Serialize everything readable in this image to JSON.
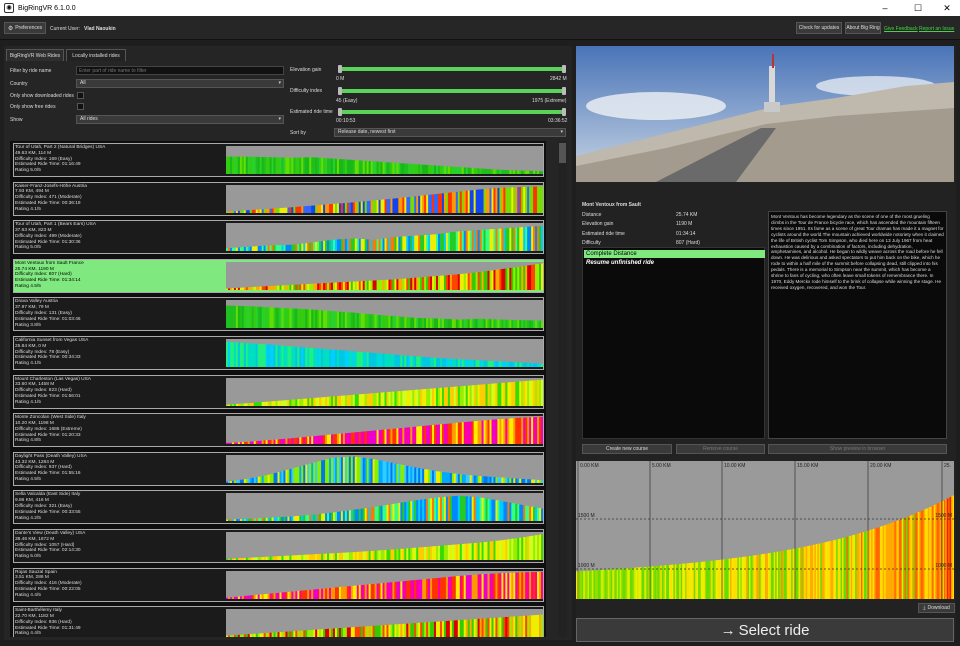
{
  "window": {
    "title": "BigRingVR 6.1.0.0",
    "minimize_glyph": "–",
    "maximize_glyph": "☐",
    "close_glyph": "✕"
  },
  "toolbar": {
    "preferences": "Preferences",
    "current_user_label": "Current User:",
    "current_user": "Vlad Naoukin",
    "check_updates": "Check for updates",
    "about": "About Big Ring",
    "feedback": "Give Feedback",
    "report_issue": "Report an Issue"
  },
  "tabs": [
    "BigRingVR Web Rides",
    "Locally installed rides"
  ],
  "filters": {
    "filter_label": "Filter by ride name",
    "filter_placeholder": "Enter part of ride name to filter",
    "country_label": "Country",
    "country_value": "All",
    "only_downloaded": "Only show downloaded rides",
    "only_free": "Only show free rides",
    "show_label": "Show",
    "show_value": "All rides",
    "elev_label": "Elevation gain",
    "elev_min": "0 M",
    "elev_max": "2842 M",
    "diff_label": "Difficulty index",
    "diff_min": "45 (Easy)",
    "diff_max": "1975 (Extreme)",
    "time_label": "Estimated ride time",
    "time_min": "00:10:53",
    "time_max": "03:36:52",
    "sort_label": "Sort by",
    "sort_value": "Release date, newest first"
  },
  "rides": [
    {
      "name": "Tour of Utah, Part 2 (Natural Bridges) USA",
      "dist": "49.63 KM, 114 M",
      "diff": "Difficulty Index: 169 (Easy)",
      "time": "Estimated Ride Time: 01:16:49",
      "rating": "Rating 5.0/5",
      "profile": [
        0.62,
        0.62,
        0.6,
        0.58,
        0.6,
        0.55,
        0.5,
        0.45,
        0.4,
        0.35,
        0.3,
        0.25,
        0.2,
        0.15,
        0.12,
        0.1
      ],
      "palette": "green",
      "selected": false
    },
    {
      "name": "Kaiser-Franz-Josefs-Höhe Austria",
      "dist": "7.93 KM, 494 M",
      "diff": "Difficulty Index: 471 (Moderate)",
      "time": "Estimated Ride Time: 00:36:19",
      "rating": "Rating 4.1/5",
      "profile": [
        0.05,
        0.1,
        0.15,
        0.2,
        0.26,
        0.32,
        0.38,
        0.45,
        0.52,
        0.6,
        0.68,
        0.76,
        0.84,
        0.9,
        0.93,
        0.95
      ],
      "palette": "warm-blue",
      "selected": false
    },
    {
      "name": "Tour of Utah, Part 1 (Bears Ears) USA",
      "dist": "37.63 KM, 823 M",
      "diff": "Difficulty Index: 499 (Moderate)",
      "time": "Estimated Ride Time: 01:30:36",
      "rating": "Rating 5.0/5",
      "profile": [
        0.1,
        0.15,
        0.2,
        0.22,
        0.3,
        0.4,
        0.45,
        0.4,
        0.5,
        0.55,
        0.6,
        0.7,
        0.75,
        0.8,
        0.85,
        0.9
      ],
      "palette": "mixed",
      "selected": false
    },
    {
      "name": "Mont Ventoux from Sault France",
      "dist": "25.74 KM, 1190 M",
      "diff": "Difficulty Index: 807 (Hard)",
      "time": "Estimated Ride Time: 01:34:14",
      "rating": "Rating 4.5/5",
      "profile": [
        0.05,
        0.1,
        0.14,
        0.18,
        0.22,
        0.26,
        0.3,
        0.34,
        0.38,
        0.44,
        0.5,
        0.56,
        0.64,
        0.74,
        0.84,
        0.95
      ],
      "palette": "green-red",
      "selected": true
    },
    {
      "name": "Drava Valley Austria",
      "dist": "37.97 KM, 79 M",
      "diff": "Difficulty Index: 131 (Easy)",
      "time": "Estimated Ride Time: 01:03:46",
      "rating": "Rating 3.8/5",
      "profile": [
        0.8,
        0.78,
        0.74,
        0.7,
        0.66,
        0.6,
        0.55,
        0.48,
        0.42,
        0.36,
        0.34,
        0.3,
        0.33,
        0.3,
        0.28,
        0.26
      ],
      "palette": "green",
      "selected": false
    },
    {
      "name": "California Sunset from Vegas USA",
      "dist": "25.84 KM, 0 M",
      "diff": "Difficulty Index: 78 (Easy)",
      "time": "Estimated Ride Time: 00:34:33",
      "rating": "Rating 4.1/5",
      "profile": [
        0.9,
        0.85,
        0.8,
        0.74,
        0.68,
        0.62,
        0.56,
        0.5,
        0.44,
        0.38,
        0.32,
        0.28,
        0.24,
        0.2,
        0.16,
        0.12
      ],
      "palette": "cyan",
      "selected": false
    },
    {
      "name": "Mount Charleston (Las Vegas) USA",
      "dist": "33.60 KM, 1458 M",
      "diff": "Difficulty Index: 823 (Hard)",
      "time": "Estimated Ride Time: 01:56:01",
      "rating": "Rating 4.1/5",
      "profile": [
        0.05,
        0.1,
        0.16,
        0.22,
        0.28,
        0.34,
        0.4,
        0.46,
        0.52,
        0.58,
        0.64,
        0.7,
        0.76,
        0.82,
        0.88,
        0.94
      ],
      "palette": "green-yellow",
      "selected": false
    },
    {
      "name": "Monte Zoncolan (West Side) Italy",
      "dist": "10.20 KM, 1198 M",
      "diff": "Difficulty Index: 1686 (Extreme)",
      "time": "Estimated Ride Time: 01:20:33",
      "rating": "Rating 4.8/5",
      "profile": [
        0.04,
        0.08,
        0.14,
        0.2,
        0.27,
        0.34,
        0.41,
        0.48,
        0.55,
        0.62,
        0.69,
        0.76,
        0.83,
        0.89,
        0.94,
        0.97
      ],
      "palette": "hot",
      "selected": false
    },
    {
      "name": "Daylight Pass (Death Valley) USA",
      "dist": "43.32 KM, 1284 M",
      "diff": "Difficulty Index: 937 (Hard)",
      "time": "Estimated Ride Time: 01:55:16",
      "rating": "Rating 4.5/5",
      "profile": [
        0.05,
        0.15,
        0.3,
        0.5,
        0.7,
        0.9,
        0.95,
        0.85,
        0.7,
        0.55,
        0.42,
        0.32,
        0.25,
        0.2,
        0.15,
        0.1
      ],
      "palette": "yellow-blue",
      "selected": false
    },
    {
      "name": "Sella Valcalda (East Side) Italy",
      "dist": "9.86 KM, 416 M",
      "diff": "Difficulty Index: 321 (Easy)",
      "time": "Estimated Ride Time: 00:33:55",
      "rating": "Rating 4.2/5",
      "profile": [
        0.05,
        0.08,
        0.12,
        0.16,
        0.22,
        0.3,
        0.4,
        0.5,
        0.62,
        0.74,
        0.84,
        0.9,
        0.85,
        0.72,
        0.58,
        0.45
      ],
      "palette": "mixed",
      "selected": false
    },
    {
      "name": "Dante's View (Death Valley) USA",
      "dist": "38.46 KM, 1672 M",
      "diff": "Difficulty Index: 1057 (Hard)",
      "time": "Estimated Ride Time: 02:14:30",
      "rating": "Rating 5.0/5",
      "profile": [
        0.04,
        0.08,
        0.12,
        0.16,
        0.2,
        0.24,
        0.28,
        0.33,
        0.38,
        0.44,
        0.5,
        0.56,
        0.62,
        0.7,
        0.8,
        0.92
      ],
      "palette": "green-yellow",
      "selected": false
    },
    {
      "name": "Rojas Sauzal Spain",
      "dist": "3.51 KM, 286 M",
      "diff": "Difficulty Index: 416 (Moderate)",
      "time": "Estimated Ride Time: 00:22:05",
      "rating": "Rating 4.4/5",
      "profile": [
        0.05,
        0.12,
        0.19,
        0.26,
        0.33,
        0.4,
        0.47,
        0.54,
        0.61,
        0.68,
        0.75,
        0.82,
        0.88,
        0.92,
        0.95,
        0.97
      ],
      "palette": "hot",
      "selected": false
    },
    {
      "name": "Saint-Barthélemy Italy",
      "dist": "22.70 KM, 1182 M",
      "diff": "Difficulty Index: 936 (Hard)",
      "time": "Estimated Ride Time: 01:31:49",
      "rating": "Rating 4.4/5",
      "profile": [
        0.05,
        0.1,
        0.15,
        0.2,
        0.25,
        0.3,
        0.35,
        0.4,
        0.45,
        0.5,
        0.55,
        0.6,
        0.65,
        0.7,
        0.75,
        0.8
      ],
      "palette": "green-red",
      "selected": false
    }
  ],
  "details": {
    "title": "Mont Ventoux from Sault",
    "rows": [
      {
        "k": "Distance",
        "v": "25.74 KM"
      },
      {
        "k": "Elevation gain",
        "v": "1190 M"
      },
      {
        "k": "Estimated ride time",
        "v": "01:34:14"
      },
      {
        "k": "Difficulty",
        "v": "807 (Hard)"
      }
    ],
    "list": [
      "Complete Distance",
      "Resume unfinished ride"
    ],
    "description": "Mont Ventoux has become legendary as the scene of one of the most grueling climbs in the Tour de France bicycle race, which has ascended the mountain fifteen times since 1951. Its fame as a scene of great Tour dramas has made it a magnet for cyclists around the world.The mountain achieved worldwide notoriety when it claimed the life of British cyclist Tom Simpson, who died here on 13 July 1967 from heat exhaustion caused by a combination of factors, including dehydration, amphetamines, and alcohol. He began to wildly weave across the road before he fell down. He was delirious and asked spectators to put him back on the bike, which he rode to within a half mile of the summit before collapsing dead, still clipped into his pedals. There is a memorial to Simpson near the summit, which has become a shrine to fans of cycling, who often leave small tokens of remembrance there. In 1970, Eddy Merckx rode himself to the brink of collapse while winning the stage. He received oxygen, recovered, and won the Tour.",
    "create_course": "Create new course",
    "remove_course": "Remove course",
    "show_preview": "Show preview in browser"
  },
  "profile_chart": {
    "km_labels": [
      "0.00 KM",
      "5.00 KM",
      "10.00 KM",
      "15.00 KM",
      "20.00 KM",
      "25."
    ],
    "elev_labels": [
      "1500 M",
      "1000 M"
    ],
    "elev_labels_right": [
      "1500 M",
      "1000 M"
    ]
  },
  "download": "Download",
  "select_ride": "Select ride",
  "colors": {
    "accent_green": "#7fe97f",
    "link_green": "#4ad14a",
    "slider_green": "#5bd35b"
  }
}
